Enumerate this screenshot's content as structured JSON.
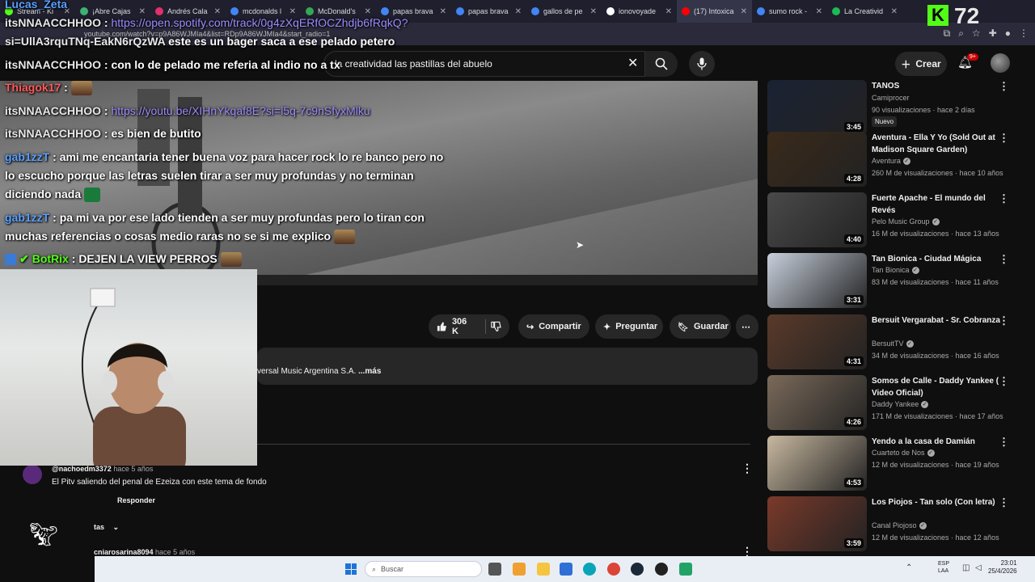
{
  "browser": {
    "tabs": [
      {
        "label": "Stream - Ki",
        "color": "#53fc18",
        "active": false
      },
      {
        "label": "¡Abre Cajas",
        "color": "#3cb371",
        "active": false
      },
      {
        "label": "Andrés Cala",
        "color": "#e1306c",
        "active": false
      },
      {
        "label": "mcdonalds l",
        "color": "#4285f4",
        "active": false
      },
      {
        "label": "McDonald's",
        "color": "#34a853",
        "active": false
      },
      {
        "label": "papas brava",
        "color": "#4285f4",
        "active": false
      },
      {
        "label": "papas brava",
        "color": "#4285f4",
        "active": false
      },
      {
        "label": "gallos de pe",
        "color": "#4285f4",
        "active": false
      },
      {
        "label": "ionovoyade",
        "color": "#ffffff",
        "active": false
      },
      {
        "label": "(17) Intoxica",
        "color": "#ff0000",
        "active": true
      },
      {
        "label": "sumo rock -",
        "color": "#4285f4",
        "active": false
      },
      {
        "label": "La Creativid",
        "color": "#1db954",
        "active": false
      }
    ],
    "url": "youtube.com/watch?v=p9A86WJMIa4&list=RDp9A86WJMIa4&start_radio=1"
  },
  "overlay": {
    "kick_count": "72",
    "kick_logo": "K"
  },
  "chat": [
    {
      "user": "Lucas_Zeta",
      "sep": "",
      "text": "",
      "link": ""
    },
    {
      "user": "itsNNAACCHHOO",
      "sep": " : ",
      "text": "",
      "link": "https://open.spotify.com/track/0g4zXqERfOCZhdjb6fRqkQ?"
    },
    {
      "user": "si=UllA3rquTNq-EakN6rQzWA",
      "sep": " ",
      "text": "este es un bager saca a ese pelado petero",
      "link": ""
    },
    {
      "user": "itsNNAACCHHOO",
      "sep": " : ",
      "text": "con lo de pelado me referia al indio no a tx",
      "link": ""
    },
    {
      "user": "Thiagok17",
      "sep": " : ",
      "text": "",
      "link": ""
    },
    {
      "user": "itsNNAACCHHOO",
      "sep": " : ",
      "text": "",
      "link": "https://youtu.be/XIHnYkqaf8E?si=l5q-7c9nSfyxMlku"
    },
    {
      "user": "itsNNAACCHHOO",
      "sep": " : ",
      "text": "es bien de butito",
      "link": ""
    },
    {
      "user": "gab1zzT",
      "sep": " : ",
      "text": "ami me encantaria tener buena voz para hacer rock lo re banco pero no",
      "link": ""
    },
    {
      "user": "",
      "sep": "",
      "text": "lo escucho porque las letras suelen tirar a ser muy profundas y no terminan",
      "link": ""
    },
    {
      "user": "",
      "sep": "",
      "text": "diciendo nada",
      "link": ""
    },
    {
      "user": "gab1zzT",
      "sep": " : ",
      "text": "pa mi va por ese lado tienden a ser muy profundas pero lo tiran con",
      "link": ""
    },
    {
      "user": "",
      "sep": "",
      "text": "muchas referencias o cosas medio raras no se si me explico",
      "link": ""
    },
    {
      "user": "BotRix",
      "sep": " : ",
      "text": "DEJEN LA VIEW PERROS",
      "link": ""
    }
  ],
  "youtube": {
    "search_query": "la creatividad las pastillas del abuelo",
    "create_label": "Crear",
    "notif_badge": "9+",
    "actions": {
      "likes": "306 K",
      "share": "Compartir",
      "ask": "Preguntar",
      "save": "Guardar"
    },
    "description": "versal Music Argentina S.A. ",
    "description_more": "...más",
    "comment": {
      "user": "@nachoedm3372",
      "time": " hace 5 años",
      "text": "El Pitv saliendo del penal de Ezeiza con este tema de fondo",
      "reply": "Responder",
      "replies_label": "tas"
    },
    "comment2_user": "cniarosarina8094",
    "comment2_time": " hace 5 años"
  },
  "recommendations": [
    {
      "title": "TANOS",
      "channel": "Camiprocer",
      "meta": "90 visualizaciones · hace 2 días",
      "duration": "3:45",
      "badge": "Nuevo",
      "verified": false,
      "thumb": "#1a2233"
    },
    {
      "title": "Aventura - Ella Y Yo (Sold Out at Madison Square Garden)",
      "channel": "Aventura",
      "meta": "260 M de visualizaciones · hace 10 años",
      "duration": "4:28",
      "verified": true,
      "thumb": "#3a2a1a"
    },
    {
      "title": "Fuerte Apache - El mundo del Revés",
      "channel": "Pelo Music Group",
      "meta": "16 M de visualizaciones · hace 13 años",
      "duration": "4:40",
      "verified": true,
      "thumb": "#4a4a4a"
    },
    {
      "title": "Tan Bionica - Ciudad Mágica",
      "channel": "Tan Bionica",
      "meta": "83 M de visualizaciones · hace 11 años",
      "duration": "3:31",
      "verified": true,
      "thumb": "#c8d0dc"
    },
    {
      "title": "Bersuit Vergarabat - Sr. Cobranza",
      "channel": "BersuitTV",
      "meta": "34 M de visualizaciones · hace 16 años",
      "duration": "4:31",
      "verified": true,
      "thumb": "#5a3a2a"
    },
    {
      "title": "Somos de Calle - Daddy Yankee ( Video Oficial)",
      "channel": "Daddy Yankee",
      "meta": "171 M de visualizaciones · hace 17 años",
      "duration": "4:26",
      "verified": true,
      "thumb": "#7a6a5a"
    },
    {
      "title": "Yendo a la casa de Damián",
      "channel": "Cuarteto de Nos",
      "meta": "12 M de visualizaciones · hace 19 años",
      "duration": "4:53",
      "verified": true,
      "thumb": "#c8b8a0"
    },
    {
      "title": "Los Piojos - Tan solo (Con letra)",
      "channel": "Canal Piojoso",
      "meta": "12 M de visualizaciones · hace 12 años",
      "duration": "3:59",
      "verified": true,
      "thumb": "#7a3a2a"
    }
  ],
  "taskbar": {
    "search_placeholder": "Buscar",
    "time": "23:01",
    "date": "25/4/2026",
    "lang1": "ESP",
    "lang2": "LAA"
  }
}
